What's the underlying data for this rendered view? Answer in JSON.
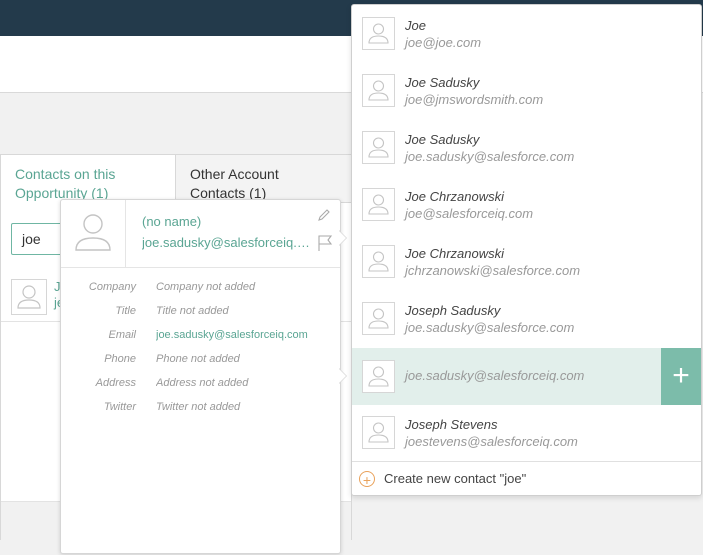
{
  "panel": {
    "tab_contacts": "Contacts on this Opportunity (1)",
    "tab_other": "Other Account Contacts (1)",
    "search_value": "joe",
    "row_letters": [
      "J",
      "je"
    ]
  },
  "card": {
    "name": "(no name)",
    "email": "joe.sadusky@salesforceiq.com",
    "fields": [
      {
        "label": "Company",
        "value": "Company not added",
        "link": false
      },
      {
        "label": "Title",
        "value": "Title not added",
        "link": false
      },
      {
        "label": "Email",
        "value": "joe.sadusky@salesforceiq.com",
        "link": true
      },
      {
        "label": "Phone",
        "value": "Phone not added",
        "link": false
      },
      {
        "label": "Address",
        "value": "Address not added",
        "link": false
      },
      {
        "label": "Twitter",
        "value": "Twitter not added",
        "link": false
      }
    ]
  },
  "dropdown": {
    "items": [
      {
        "name": "Joe",
        "email": "joe@joe.com"
      },
      {
        "name": "Joe Sadusky",
        "email": "joe@jmswordsmith.com"
      },
      {
        "name": "Joe Sadusky",
        "email": "joe.sadusky@salesforce.com"
      },
      {
        "name": "Joe Chrzanowski",
        "email": "joe@salesforceiq.com"
      },
      {
        "name": "Joe Chrzanowski",
        "email": "jchrzanowski@salesforce.com"
      },
      {
        "name": "Joseph Sadusky",
        "email": "joe.sadusky@salesforce.com"
      },
      {
        "name": "",
        "email": "joe.sadusky@salesforceiq.com",
        "active": true
      },
      {
        "name": "Joseph Stevens",
        "email": "joestevens@salesforceiq.com"
      }
    ],
    "add_symbol": "+",
    "create_plus": "+",
    "create_label": "Create new contact \"joe\""
  },
  "colors": {
    "topbar": "#233a4b",
    "accent": "#5aa593",
    "add_button": "#7cbcaa",
    "active_row": "#e2efeb",
    "create_icon": "#e9a25b"
  },
  "icons": [
    "person-icon",
    "pencil-icon",
    "flag-icon",
    "plus-icon"
  ]
}
